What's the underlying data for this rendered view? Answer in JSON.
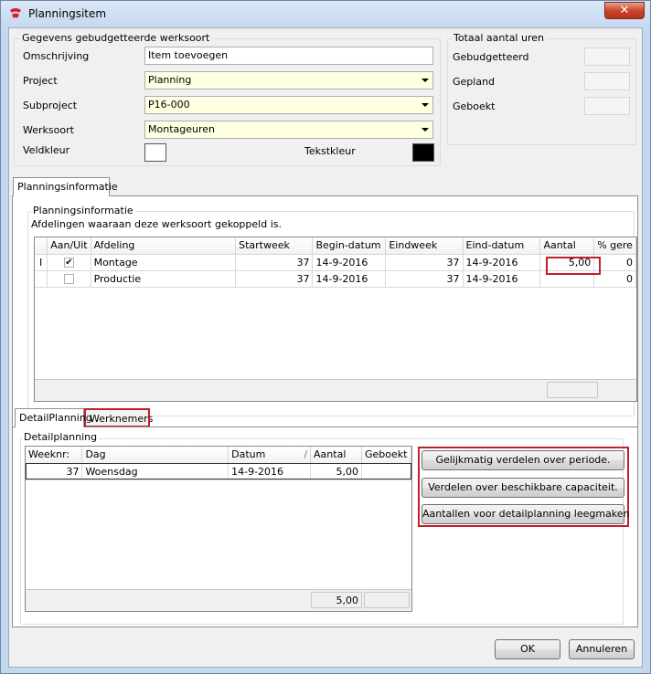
{
  "window": {
    "title": "Planningsitem",
    "close_glyph": "✕"
  },
  "budget_group": {
    "title": "Gegevens gebudgetteerde werksoort",
    "omschrijving_label": "Omschrijving",
    "omschrijving_value": "Item toevoegen",
    "project_label": "Project",
    "project_value": "Planning",
    "subproject_label": "Subproject",
    "subproject_value": "P16-000",
    "werksoort_label": "Werksoort",
    "werksoort_value": "Montageuren",
    "veldkleur_label": "Veldkleur",
    "tekstkleur_label": "Tekstkleur",
    "veldkleur_color": "#ffffff",
    "tekstkleur_color": "#000000"
  },
  "totals_group": {
    "title": "Totaal aantal uren",
    "gebudgetteerd_label": "Gebudgetteerd",
    "gepland_label": "Gepland",
    "geboekt_label": "Geboekt"
  },
  "main_tab": {
    "label": "Planningsinformatie"
  },
  "planning_group": {
    "title": "Planningsinformatie",
    "description": "Afdelingen waaraan deze werksoort gekoppeld is."
  },
  "dept_table": {
    "columns": [
      "Aan/Uit",
      "Afdeling",
      "Startweek",
      "Begin-datum",
      "Eindweek",
      "Eind-datum",
      "Aantal",
      "% gere"
    ],
    "row_indicator": "I",
    "rows": [
      {
        "checked": true,
        "check_glyph": "✔",
        "afdeling": "Montage",
        "startweek": "37",
        "begin": "14-9-2016",
        "eindweek": "37",
        "eind": "14-9-2016",
        "aantal": "5,00",
        "perc": "0"
      },
      {
        "checked": false,
        "check_glyph": "",
        "afdeling": "Productie",
        "startweek": "37",
        "begin": "14-9-2016",
        "eindweek": "37",
        "eind": "14-9-2016",
        "aantal": "",
        "perc": "0"
      }
    ]
  },
  "sub_tabs": {
    "detail": "DetailPlanning",
    "werknemers": "Werknemers"
  },
  "detail_group": {
    "title": "Detailplanning"
  },
  "detail_table": {
    "columns": [
      "Weeknr:",
      "Dag",
      "Datum",
      "Aantal",
      "Geboekt"
    ],
    "sort_glyph": "/",
    "rows": [
      {
        "weeknr": "37",
        "dag": "Woensdag",
        "datum": "14-9-2016",
        "aantal": "5,00",
        "geboekt": ""
      }
    ],
    "footer_total": "5,00"
  },
  "actions": {
    "gelijkmatig": "Gelijkmatig verdelen over periode.",
    "capaciteit": "Verdelen over beschikbare capaciteit.",
    "leegmaken": "Aantallen voor detailplanning leegmaken"
  },
  "buttons": {
    "ok": "OK",
    "annuleren": "Annuleren"
  },
  "colors": {
    "highlight": "#c0202a",
    "required_field": "#ffffe1"
  }
}
